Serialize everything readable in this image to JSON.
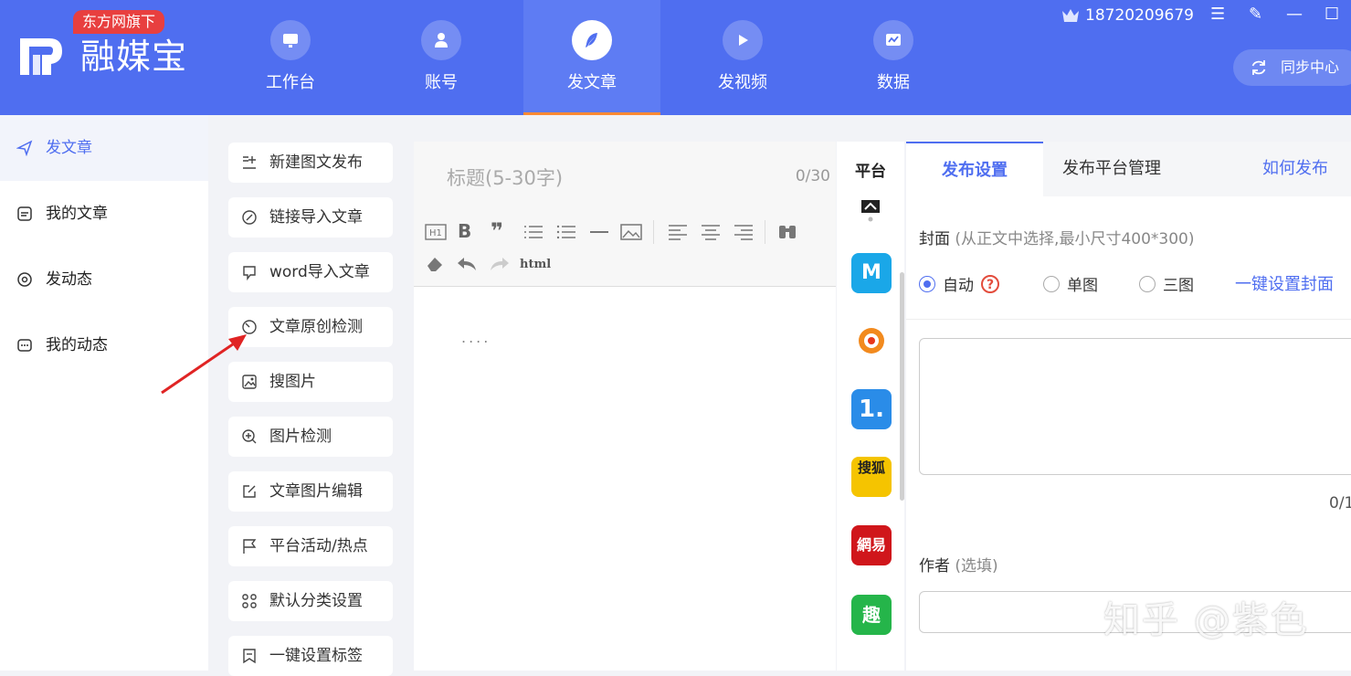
{
  "app": {
    "badge": "东方网旗下",
    "name": "融媒宝",
    "brand_color": "#4f6ef0"
  },
  "nav": [
    {
      "label": "工作台",
      "icon": "monitor-icon"
    },
    {
      "label": "账号",
      "icon": "user-icon"
    },
    {
      "label": "发文章",
      "icon": "feather-icon",
      "active": true
    },
    {
      "label": "发视频",
      "icon": "play-icon"
    },
    {
      "label": "数据",
      "icon": "chart-icon"
    }
  ],
  "user": {
    "phone": "18720209679"
  },
  "window_controls": {
    "menu": "☰",
    "edit": "✎",
    "minimize": "—",
    "maximize": "☐"
  },
  "sync_label": "同步中心",
  "sidebar": [
    {
      "label": "发文章",
      "active": true
    },
    {
      "label": "我的文章"
    },
    {
      "label": "发动态"
    },
    {
      "label": "我的动态"
    }
  ],
  "tools": [
    {
      "label": "新建图文发布",
      "icon": "new-article-icon"
    },
    {
      "label": "链接导入文章",
      "icon": "link-icon"
    },
    {
      "label": "word导入文章",
      "icon": "word-import-icon"
    },
    {
      "label": "文章原创检测",
      "icon": "originality-check-icon"
    },
    {
      "label": "搜图片",
      "icon": "image-search-icon"
    },
    {
      "label": "图片检测",
      "icon": "zoom-in-icon"
    },
    {
      "label": "文章图片编辑",
      "icon": "edit-image-icon"
    },
    {
      "label": "平台活动/热点",
      "icon": "flag-icon"
    },
    {
      "label": "默认分类设置",
      "icon": "category-icon"
    },
    {
      "label": "一键设置标签",
      "icon": "tag-icon"
    }
  ],
  "editor": {
    "title_placeholder": "标题(5-30字)",
    "title_count": "0/30",
    "html_label": "html",
    "body_placeholder": "...."
  },
  "platforms": {
    "header": "平台",
    "items": [
      {
        "name": "ucloud-platform-icon",
        "color": "#ffffff",
        "text": ""
      },
      {
        "name": "zhihu-mini-platform-icon",
        "color": "#1aa7e8",
        "text": "M"
      },
      {
        "name": "weibo-platform-icon",
        "color": "#ffffff",
        "text": ""
      },
      {
        "name": "yidian-platform-icon",
        "color": "#2a8ce8",
        "text": "1."
      },
      {
        "name": "sohu-platform-icon",
        "color": "#f5c400",
        "text": "搜狐"
      },
      {
        "name": "netease-platform-icon",
        "color": "#d0161b",
        "text": "網易"
      },
      {
        "name": "qutoutiao-platform-icon",
        "color": "#25b54a",
        "text": "趣"
      }
    ]
  },
  "settings": {
    "tabs": [
      "发布设置",
      "发布平台管理",
      "如何发布"
    ],
    "cover_label": "封面",
    "cover_hint": "(从正文中选择,最小尺寸400*300)",
    "options": [
      "自动",
      "单图",
      "三图"
    ],
    "one_click_cover": "一键设置封面",
    "summary_count": "0/1",
    "author_label": "作者",
    "author_hint": "(选填)"
  },
  "watermark": "知乎 @紫色"
}
